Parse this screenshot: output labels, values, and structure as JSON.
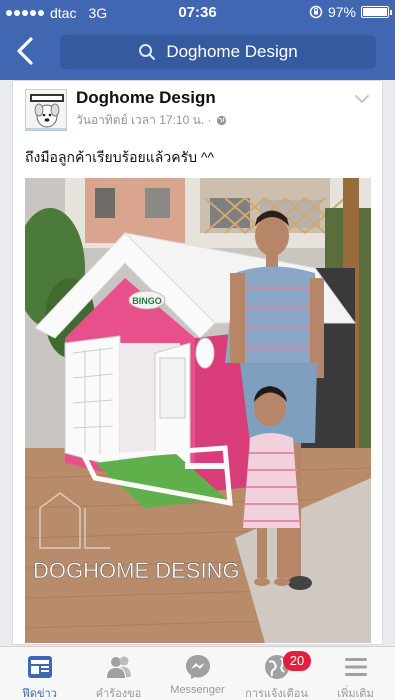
{
  "status_bar": {
    "carrier": "dtac",
    "network": "3G",
    "time": "07:36",
    "battery": "97%"
  },
  "nav": {
    "search_text": "Doghome Design"
  },
  "post": {
    "author": "Doghome Design",
    "meta": "วันอาทิตย์ เวลา 17:10 น. ·",
    "caption": "ถึงมือลูกค้าเรียบร้อยแล้วครับ ^^",
    "photo": {
      "watermark": "DOGHOME DESING",
      "sign_text": "BINGO"
    }
  },
  "tabs": [
    {
      "label": "ฟีดข่าว",
      "icon": "news-feed-icon",
      "active": true
    },
    {
      "label": "คำร้องขอ",
      "icon": "friend-requests-icon"
    },
    {
      "label": "Messenger",
      "icon": "messenger-icon"
    },
    {
      "label": "การแจ้งเตือน",
      "icon": "notifications-globe-icon",
      "badge": "20"
    },
    {
      "label": "เพิ่มเติม",
      "icon": "more-menu-icon"
    }
  ],
  "colors": {
    "brand": "#4267b2",
    "badge": "#e41e3f"
  }
}
